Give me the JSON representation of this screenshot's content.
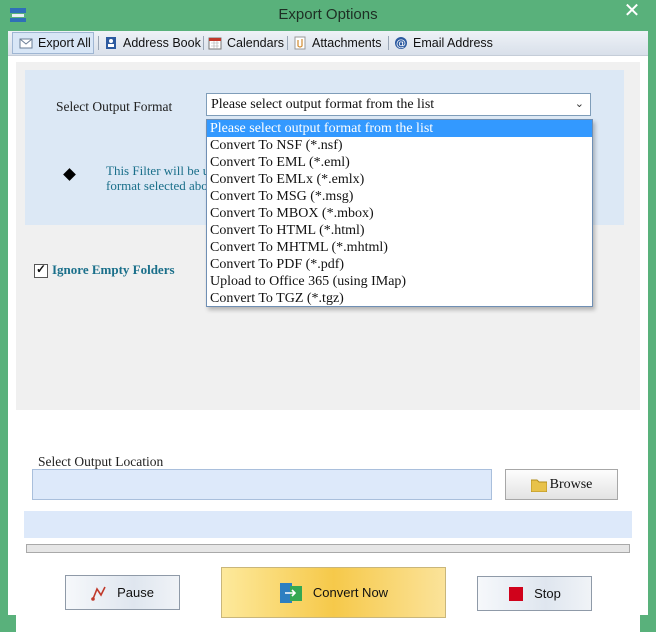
{
  "window": {
    "title": "Export Options",
    "close_glyph": "✕"
  },
  "tabs": [
    {
      "label": "Export All",
      "icon": "envelope-icon"
    },
    {
      "label": "Address Book",
      "icon": "address-book-icon"
    },
    {
      "label": "Calendars",
      "icon": "calendar-icon"
    },
    {
      "label": "Attachments",
      "icon": "paperclip-icon"
    },
    {
      "label": "Email Address",
      "icon": "at-sign-icon"
    }
  ],
  "format": {
    "label": "Select Output Format",
    "selected": "Please select output format from the list",
    "options": [
      "Please select output format from the list",
      "Convert To NSF (*.nsf)",
      "Convert To EML (*.eml)",
      "Convert To EMLx (*.emlx)",
      "Convert To MSG (*.msg)",
      "Convert To MBOX (*.mbox)",
      "Convert To HTML (*.html)",
      "Convert To MHTML (*.mhtml)",
      "Convert To PDF (*.pdf)",
      "Upload to Office 365 (using IMap)",
      "Convert To TGZ (*.tgz)"
    ],
    "filter_text_line1": "This Filter will be us",
    "filter_text_line2": "format selected abov"
  },
  "ignore_empty": {
    "label": "Ignore Empty Folders",
    "checked": true
  },
  "output": {
    "label": "Select Output Location",
    "value": "",
    "browse_label": "Browse"
  },
  "progress": {
    "value": 0
  },
  "buttons": {
    "pause": "Pause",
    "convert": "Convert Now",
    "stop": "Stop"
  },
  "colors": {
    "title_bar": "#59b17b",
    "accent": "#3399ff",
    "filter_text": "#1a6f8a",
    "convert_button": "#f6c94a"
  }
}
